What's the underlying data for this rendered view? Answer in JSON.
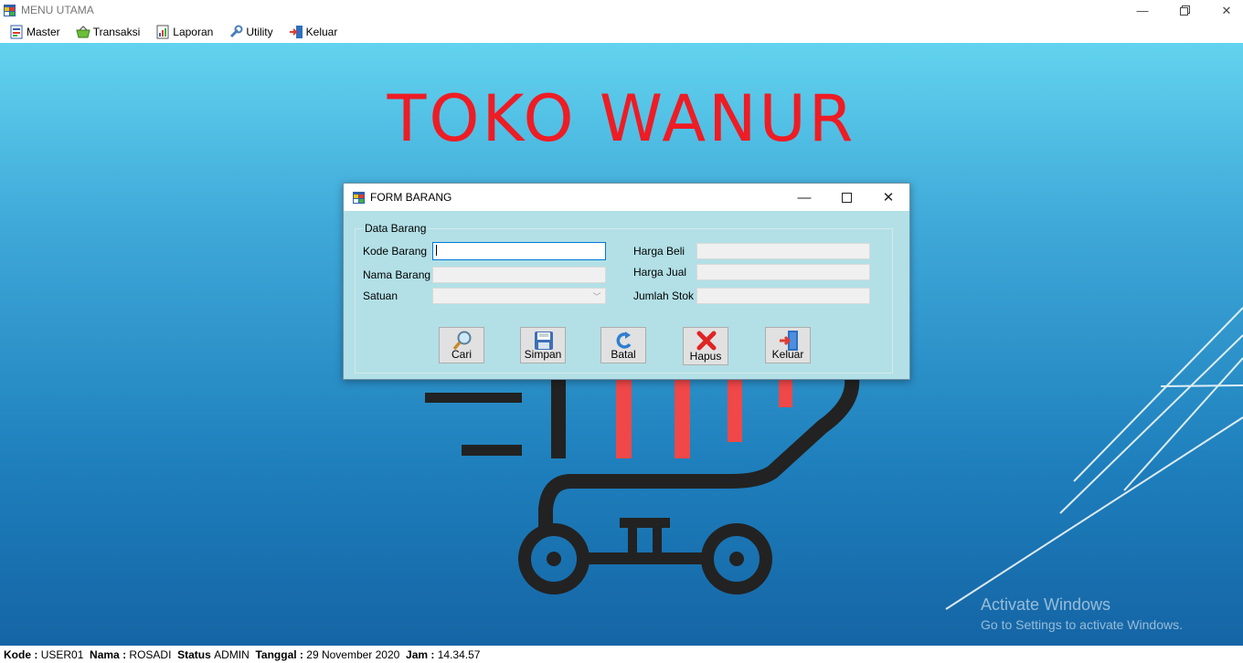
{
  "window": {
    "title": "MENU UTAMA"
  },
  "menu": [
    {
      "label": "Master",
      "icon": "form-icon"
    },
    {
      "label": "Transaksi",
      "icon": "basket-icon"
    },
    {
      "label": "Laporan",
      "icon": "report-icon"
    },
    {
      "label": "Utility",
      "icon": "wrench-icon"
    },
    {
      "label": "Keluar",
      "icon": "exit-icon"
    }
  ],
  "brand": {
    "text": "TOKO WANUR",
    "color": "#ee1c24"
  },
  "activation": {
    "line1": "Activate Windows",
    "line2": "Go to Settings to activate Windows."
  },
  "dialog": {
    "title": "FORM BARANG",
    "group_label": "Data Barang",
    "fields": {
      "kode_barang": {
        "label": "Kode Barang",
        "value": ""
      },
      "nama_barang": {
        "label": "Nama Barang",
        "value": ""
      },
      "satuan": {
        "label": "Satuan",
        "value": ""
      },
      "harga_beli": {
        "label": "Harga Beli",
        "value": ""
      },
      "harga_jual": {
        "label": "Harga Jual",
        "value": ""
      },
      "jumlah_stok": {
        "label": "Jumlah Stok",
        "value": ""
      }
    },
    "buttons": {
      "cari": "Cari",
      "simpan": "Simpan",
      "batal": "Batal",
      "hapus": "Hapus",
      "keluar": "Keluar"
    }
  },
  "status": {
    "kode_label": "Kode :",
    "kode": "USER01",
    "nama_label": "Nama :",
    "nama": "ROSADI",
    "status_label": "Status",
    "status": "ADMIN",
    "tanggal_label": "Tanggal :",
    "tanggal": "29 November 2020",
    "jam_label": "Jam :",
    "jam": "14.34.57"
  }
}
